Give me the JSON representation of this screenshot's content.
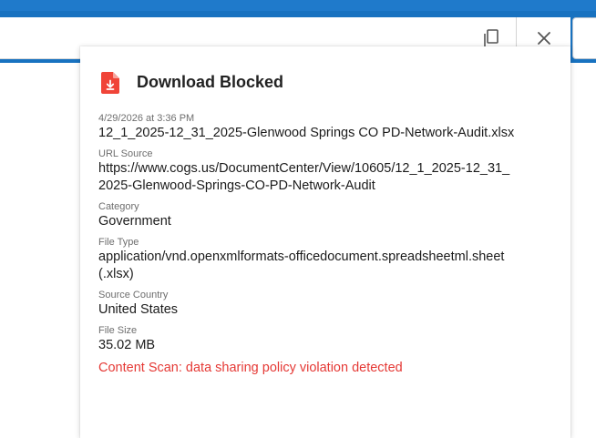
{
  "panel": {
    "title": "Download Blocked",
    "timestamp": "4/29/2026 at 3:36 PM",
    "filename": "12_1_2025-12_31_2025-Glenwood Springs CO PD-Network-Audit.xlsx",
    "url_label": "URL Source",
    "url_line1": "https://www.cogs.us/DocumentCenter/View/10605/12_1_2025-12_31_",
    "url_line2": "2025-Glenwood-Springs-CO-PD-Network-Audit",
    "category_label": "Category",
    "category_value": "Government",
    "filetype_label": "File Type",
    "filetype_line1": "application/vnd.openxmlformats-officedocument.spreadsheetml.sheet",
    "filetype_line2": "(.xlsx)",
    "country_label": "Source Country",
    "country_value": "United States",
    "filesize_label": "File Size",
    "filesize_value": "35.02 MB",
    "warning": "Content Scan: data sharing policy violation detected"
  },
  "icons": {
    "copy": "copy-icon",
    "close": "close-icon",
    "file": "file-download-blocked-icon"
  },
  "colors": {
    "top_bar": "#1872c0",
    "icon_red": "#f04438",
    "warning_red": "#e53935"
  }
}
